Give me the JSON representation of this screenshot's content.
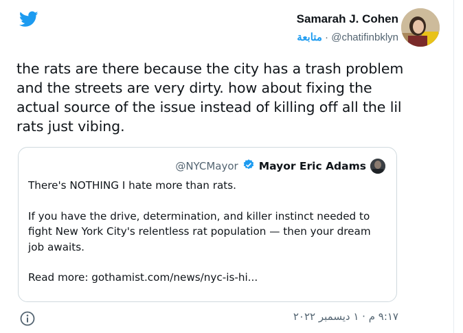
{
  "tweet": {
    "author_name": "Samarah J. Cohen",
    "author_handle": "@chatifinbklyn",
    "separator": "·",
    "follow_label": "متابعة",
    "text": "the rats are there because the city has a trash problem and the streets are very dirty. how about fixing the actual source of the issue instead of killing off all the lil rats just vibing.",
    "timestamp": "٩:١٧ م · ١ ديسمبر ٢٠٢٢"
  },
  "quote": {
    "handle": "@NYCMayor",
    "name": "Mayor Eric Adams",
    "line1": "There's NOTHING I hate more than rats.",
    "line2": "If you have the drive, determination, and killer instinct needed to fight New York City's relentless rat population — then your dream job awaits.",
    "line3": "Read more: gothamist.com/news/nyc-is-hi..."
  },
  "colors": {
    "brand": "#1d9bf0",
    "text": "#0f1419",
    "secondary": "#536471",
    "border": "#cfd9de"
  },
  "icons": {
    "logo": "twitter-bird-icon",
    "verified": "verified-badge-icon",
    "info": "info-icon"
  }
}
